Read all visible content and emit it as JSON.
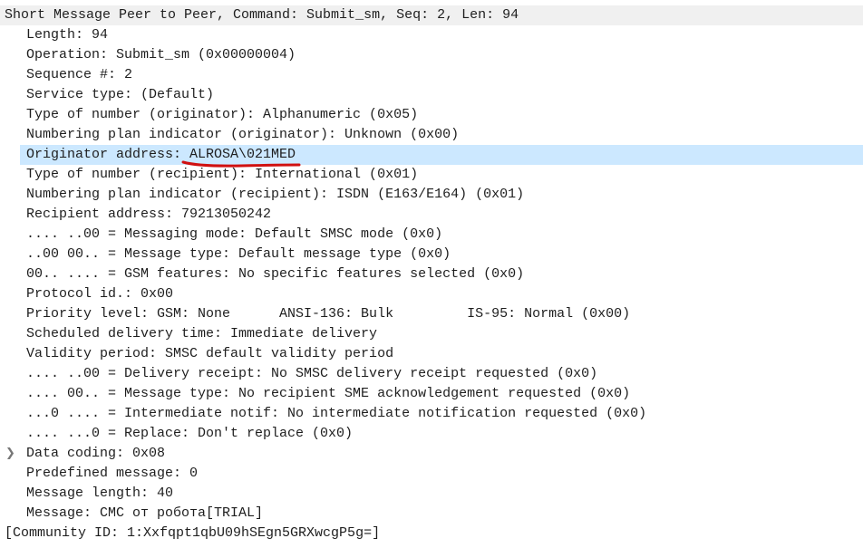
{
  "tree": {
    "header": "Short Message Peer to Peer, Command: Submit_sm, Seq: 2, Len: 94",
    "items": [
      {
        "text": "Length: 94"
      },
      {
        "text": "Operation: Submit_sm (0x00000004)"
      },
      {
        "text": "Sequence #: 2"
      },
      {
        "text": "Service type: (Default)"
      },
      {
        "text": "Type of number (originator): Alphanumeric (0x05)"
      },
      {
        "text": "Numbering plan indicator (originator): Unknown (0x00)"
      },
      {
        "text": "Originator address: ALROSA\\021MED",
        "selected": true
      },
      {
        "text": "Type of number (recipient): International (0x01)"
      },
      {
        "text": "Numbering plan indicator (recipient): ISDN (E163/E164) (0x01)"
      },
      {
        "text": "Recipient address: 79213050242"
      },
      {
        "text": ".... ..00 = Messaging mode: Default SMSC mode (0x0)"
      },
      {
        "text": "..00 00.. = Message type: Default message type (0x0)"
      },
      {
        "text": "00.. .... = GSM features: No specific features selected (0x0)"
      },
      {
        "text": "Protocol id.: 0x00"
      },
      {
        "text": "Priority level: GSM: None      ANSI-136: Bulk         IS-95: Normal (0x00)"
      },
      {
        "text": "Scheduled delivery time: Immediate delivery"
      },
      {
        "text": "Validity period: SMSC default validity period"
      },
      {
        "text": ".... ..00 = Delivery receipt: No SMSC delivery receipt requested (0x0)"
      },
      {
        "text": ".... 00.. = Message type: No recipient SME acknowledgement requested (0x0)"
      },
      {
        "text": "...0 .... = Intermediate notif: No intermediate notification requested (0x0)"
      },
      {
        "text": ".... ...0 = Replace: Don't replace (0x0)"
      },
      {
        "text": "Data coding: 0x08",
        "expandable": true
      },
      {
        "text": "Predefined message: 0"
      },
      {
        "text": "Message length: 40"
      },
      {
        "text": "Message: СМС от робота[TRIAL]"
      }
    ],
    "footer": "[Community ID: 1:Xxfqpt1qbU09hSEgn5GRXwcgP5g=]"
  },
  "colors": {
    "selection": "#cce8ff",
    "header_bg": "#f0f0f0",
    "annotation": "#d01010"
  },
  "icons": {
    "expander": "chevron-right-icon"
  }
}
